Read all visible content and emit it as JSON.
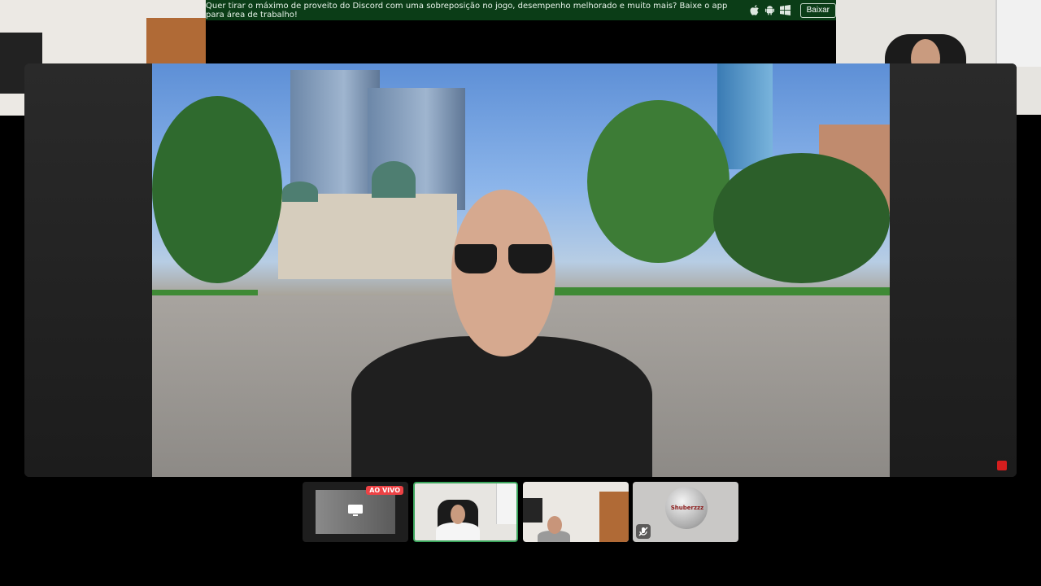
{
  "banner": {
    "message": "Quer tirar o máximo de proveito do Discord com uma sobreposição no jogo, desempenho melhorado e muito mais? Baixe o app para área de trabalho!",
    "platform_icons": [
      "apple-icon",
      "android-icon",
      "windows-icon"
    ],
    "download_label": "Baixar"
  },
  "participants": {
    "left_camera": "webcam-participant-headset",
    "right_camera": "webcam-participant-glasses"
  },
  "stage": {
    "content": "screen-share-stream"
  },
  "tiles": {
    "stream_tile": {
      "live_label": "AO VIVO",
      "icon": "screen-share-icon"
    },
    "camera_tile_1": "webcam",
    "camera_tile_2": "webcam",
    "avatar_tile": {
      "logo_text": "Shuberzzz",
      "icon": "mic-muted-icon"
    }
  },
  "colors": {
    "banner_bg": "#0b3d17",
    "speaking_border": "#3ba55c",
    "live_red": "#ed4245"
  }
}
